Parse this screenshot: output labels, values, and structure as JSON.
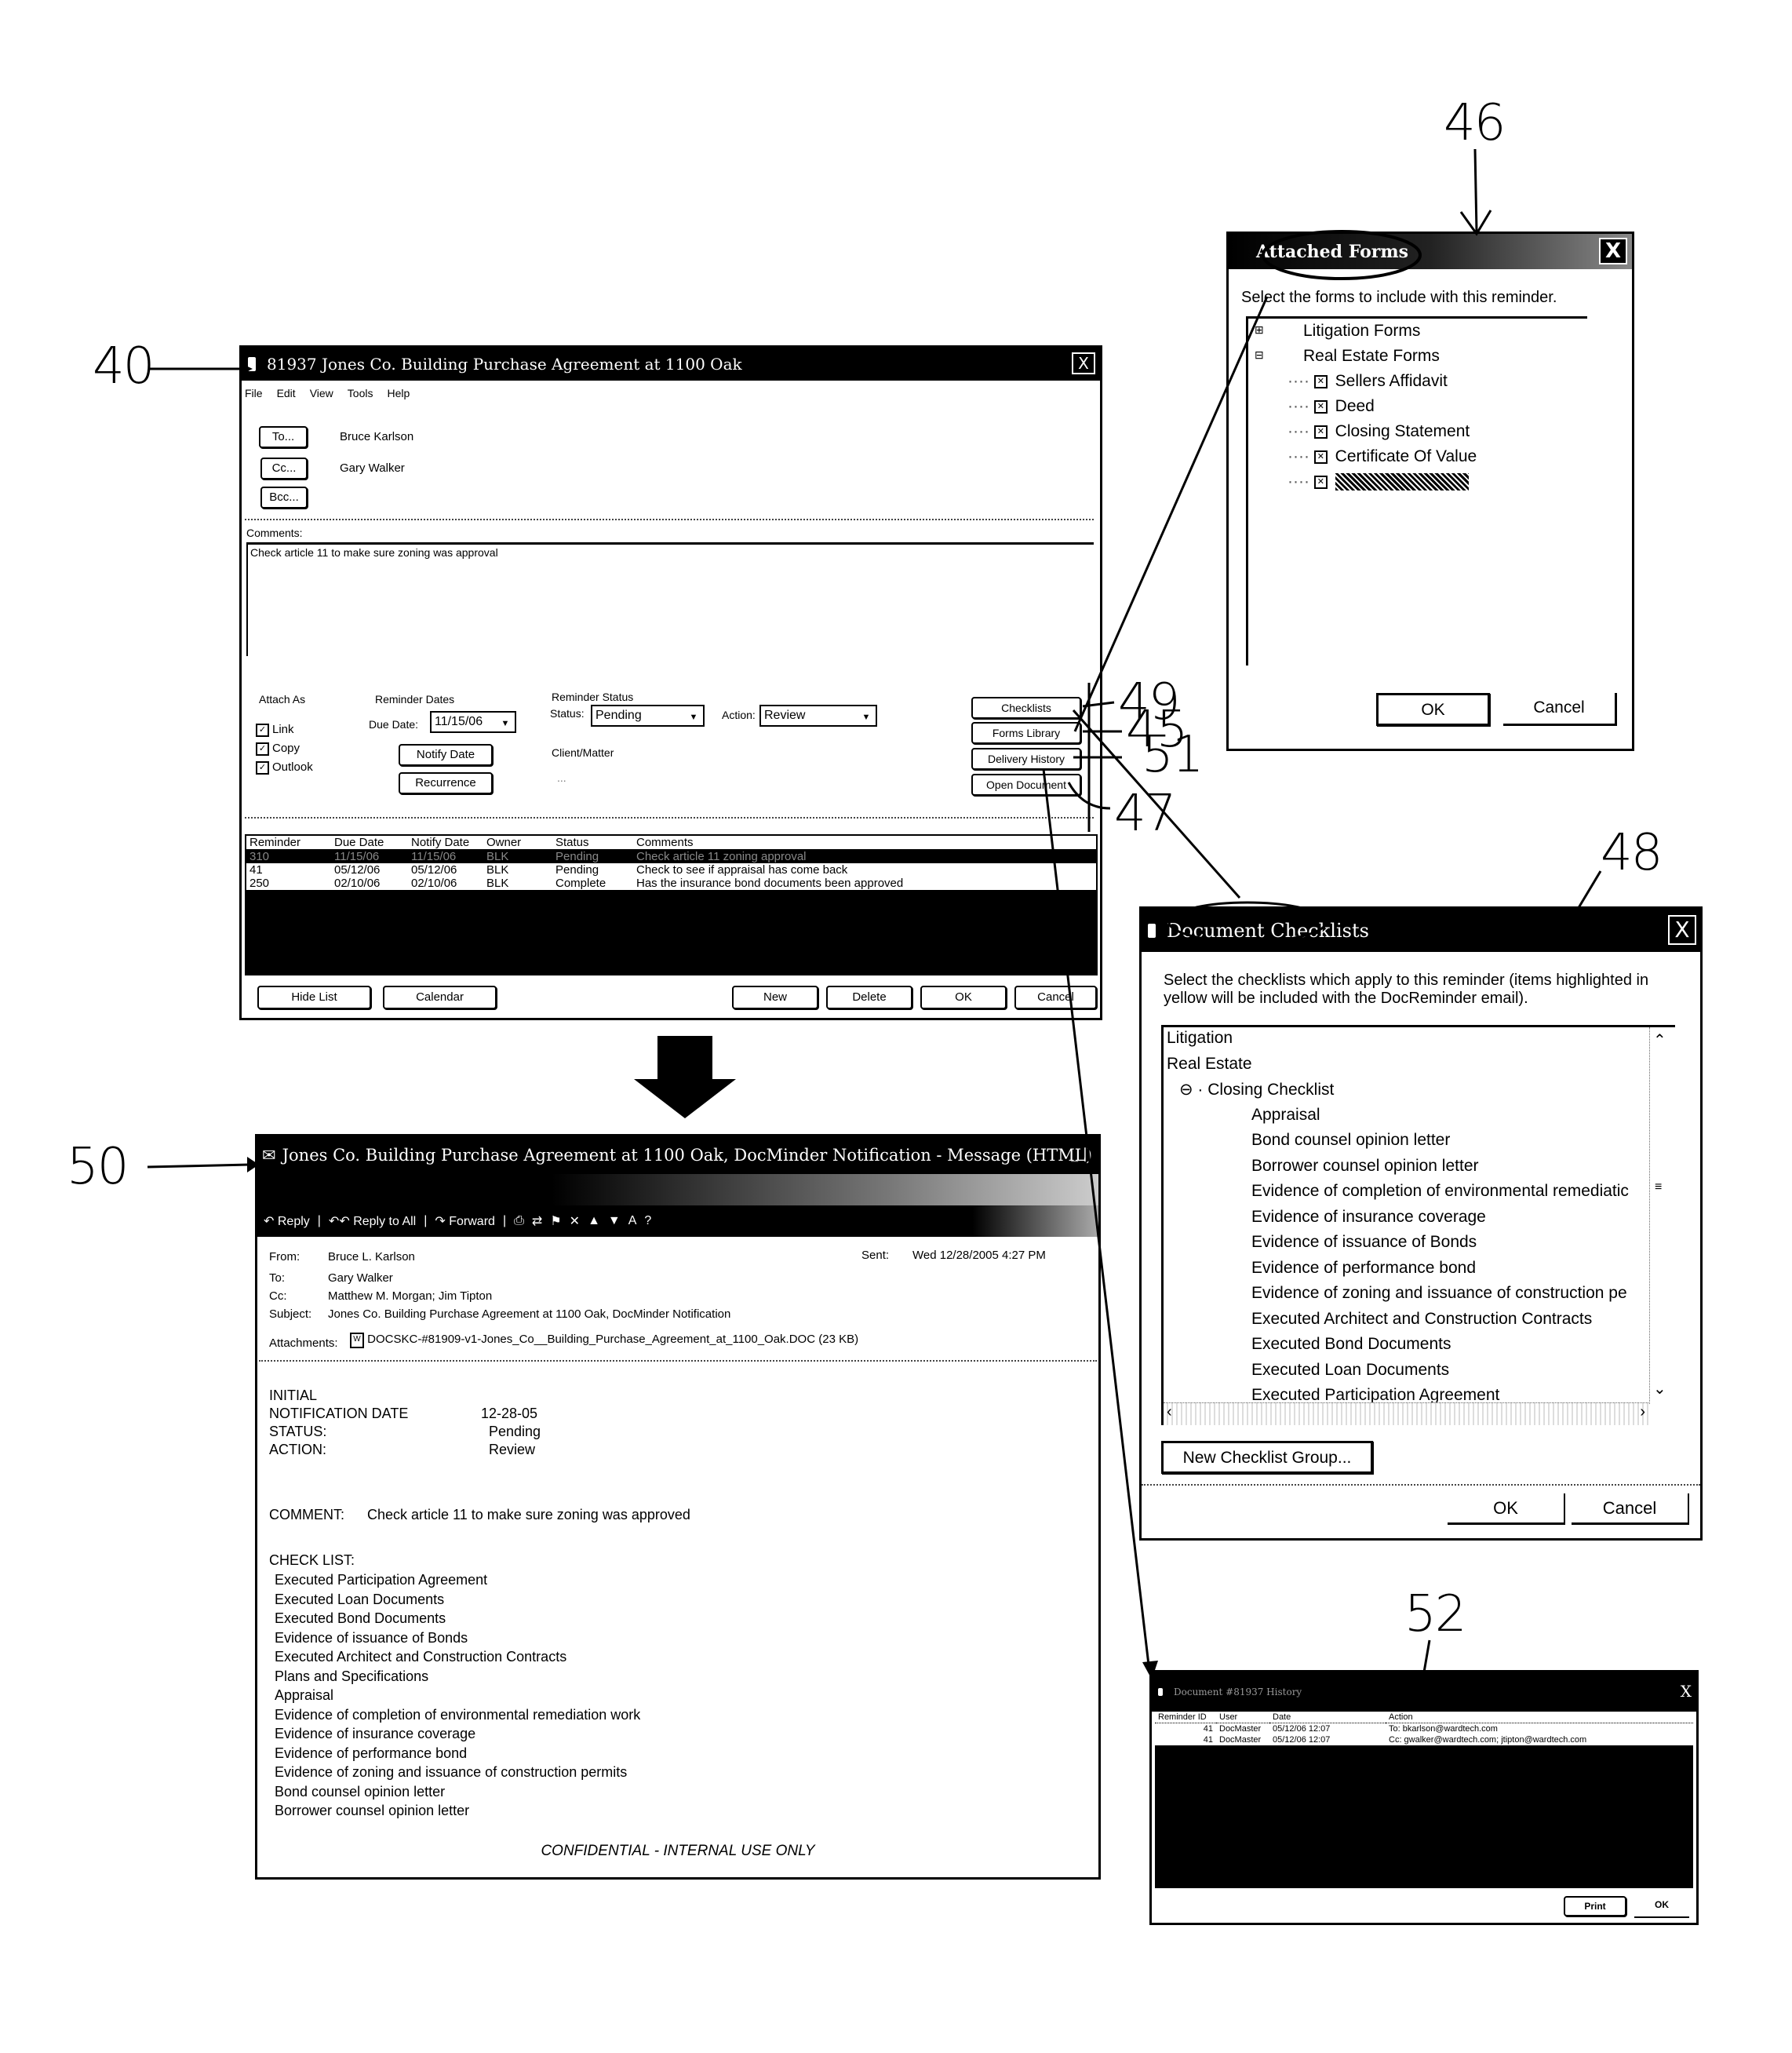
{
  "figure": {
    "ref_numerals": {
      "main_window": "40",
      "attached_forms": "46",
      "checklists_button": "49",
      "forms_library_button": "45",
      "delivery_history_button": "51",
      "open_document_button": "47",
      "document_checklists": "48",
      "email_message": "50",
      "history_window": "52"
    }
  },
  "reminder_window": {
    "title": "81937 Jones Co. Building Purchase Agreement at 1100 Oak",
    "close_label": "X",
    "menu": [
      "File",
      "Edit",
      "View",
      "Tools",
      "Help"
    ],
    "to_button": "To...",
    "cc_button": "Cc...",
    "bcc_button": "Bcc...",
    "to_value": "Bruce Karlson",
    "cc_value": "Gary Walker",
    "bcc_value": "",
    "comments_label": "Comments:",
    "comments_value": "Check article 11 to make sure zoning was approval",
    "attach_as_label": "Attach As",
    "attach_options": [
      {
        "label": "Link",
        "checked": true
      },
      {
        "label": "Copy",
        "checked": true
      },
      {
        "label": "Outlook",
        "checked": true
      }
    ],
    "reminder_dates_label": "Reminder Dates",
    "due_date_label": "Due Date:",
    "due_date_value": "11/15/06",
    "notify_date_button": "Notify Date",
    "recurrence_button": "Recurrence",
    "reminder_status_label": "Reminder Status",
    "status_label": "Status:",
    "status_value": "Pending",
    "action_label": "Action:",
    "action_value": "Review",
    "client_matter_label": "Client/Matter",
    "client_matter_value": "...",
    "checklists_button": "Checklists",
    "forms_library_button": "Forms Library",
    "delivery_history_button": "Delivery History",
    "open_document_button": "Open Document",
    "table": {
      "columns": [
        "Reminder",
        "Due Date",
        "Notify Date",
        "Owner",
        "Status",
        "Comments"
      ],
      "rows": [
        {
          "reminder": "310",
          "due": "11/15/06",
          "notify": "11/15/06",
          "owner": "BLK",
          "status": "Pending",
          "comments": "Check article 11 zoning approval",
          "selected": true
        },
        {
          "reminder": "41",
          "due": "05/12/06",
          "notify": "05/12/06",
          "owner": "BLK",
          "status": "Pending",
          "comments": "Check to see if appraisal has come back",
          "selected": false
        },
        {
          "reminder": "250",
          "due": "02/10/06",
          "notify": "02/10/06",
          "owner": "BLK",
          "status": "Complete",
          "comments": "Has the insurance bond documents been approved",
          "selected": false
        }
      ]
    },
    "hide_list_button": "Hide List",
    "calendar_button": "Calendar",
    "new_button": "New",
    "delete_button": "Delete",
    "ok_button": "OK",
    "cancel_button": "Cancel"
  },
  "attached_forms": {
    "title": "Attached Forms",
    "close_label": "X",
    "instruction": "Select the forms to include with this reminder.",
    "groups": [
      {
        "label": "Litigation Forms",
        "expanded": false,
        "items": []
      },
      {
        "label": "Real Estate Forms",
        "expanded": true,
        "items": [
          {
            "label": "Sellers Affidavit",
            "checked": true
          },
          {
            "label": "Deed",
            "checked": true
          },
          {
            "label": "Closing Statement",
            "checked": true
          },
          {
            "label": "Certificate Of Value",
            "checked": true
          },
          {
            "label": "",
            "checked": true,
            "highlighted": true
          }
        ]
      }
    ],
    "ok_button": "OK",
    "cancel_button": "Cancel"
  },
  "document_checklists": {
    "title": "Document Checklists",
    "close_label": "X",
    "instruction": "Select the checklists which apply to this reminder (items highlighted in yellow will be included with the DocReminder email).",
    "tree": [
      {
        "label": "Litigation",
        "level": 0
      },
      {
        "label": "Real Estate",
        "level": 0
      },
      {
        "label": "Closing Checklist",
        "level": 1,
        "expanded": true
      },
      {
        "label": "Appraisal",
        "level": 2
      },
      {
        "label": "Bond counsel opinion letter",
        "level": 2
      },
      {
        "label": "Borrower counsel opinion letter",
        "level": 2
      },
      {
        "label": "Evidence of completion of environmental remediatic",
        "level": 2
      },
      {
        "label": "Evidence of insurance coverage",
        "level": 2
      },
      {
        "label": "Evidence of issuance of Bonds",
        "level": 2
      },
      {
        "label": "Evidence of performance bond",
        "level": 2
      },
      {
        "label": "Evidence of zoning and issuance of construction pe",
        "level": 2
      },
      {
        "label": "Executed Architect and Construction Contracts",
        "level": 2
      },
      {
        "label": "Executed Bond Documents",
        "level": 2
      },
      {
        "label": "Executed Loan Documents",
        "level": 2
      },
      {
        "label": "Executed Participation Agreement",
        "level": 2
      }
    ],
    "new_group_button": "New Checklist Group...",
    "ok_button": "OK",
    "cancel_button": "Cancel"
  },
  "email": {
    "title": "Jones Co. Building Purchase Agreement at 1100 Oak, DocMinder Notification - Message (HTML)",
    "toolbar": {
      "reply": "Reply",
      "reply_all": "Reply to All",
      "forward": "Forward"
    },
    "from_label": "From:",
    "from_value": "Bruce L. Karlson",
    "sent_label": "Sent:",
    "sent_value": "Wed 12/28/2005 4:27 PM",
    "to_label": "To:",
    "to_value": "Gary Walker",
    "cc_label": "Cc:",
    "cc_value": "Matthew M. Morgan; Jim Tipton",
    "subject_label": "Subject:",
    "subject_value": "Jones Co. Building Purchase Agreement at 1100 Oak, DocMinder Notification",
    "attachments_label": "Attachments:",
    "attachment_value": "DOCSKC-#81909-v1-Jones_Co__Building_Purchase_Agreement_at_1100_Oak.DOC (23 KB)",
    "body": {
      "initial_label": "INITIAL",
      "notification_date_label": "NOTIFICATION DATE",
      "notification_date_value": "12-28-05",
      "status_label": "STATUS:",
      "status_value": "Pending",
      "action_label": "ACTION:",
      "action_value": "Review",
      "comment_label": "COMMENT:",
      "comment_value": "Check article 11 to make sure zoning was approved",
      "checklist_label": "CHECK LIST:",
      "checklist": [
        "Executed Participation Agreement",
        "Executed Loan Documents",
        "Executed Bond Documents",
        "Evidence of issuance of Bonds",
        "Executed Architect and Construction Contracts",
        "Plans and Specifications",
        "Appraisal",
        "Evidence of completion of environmental remediation work",
        "Evidence of insurance coverage",
        "Evidence of performance bond",
        "Evidence of zoning and issuance of construction permits",
        "Bond counsel opinion letter",
        "Borrower counsel opinion letter"
      ],
      "footer": "CONFIDENTIAL - INTERNAL USE ONLY"
    }
  },
  "history": {
    "title": "Document #81937 History",
    "close_label": "X",
    "columns": [
      "Reminder ID",
      "User",
      "Date",
      "Action"
    ],
    "rows": [
      {
        "id": "41",
        "user": "DocMaster",
        "date": "05/12/06 12:07",
        "action": "To: bkarlson@wardtech.com"
      },
      {
        "id": "41",
        "user": "DocMaster",
        "date": "05/12/06 12:07",
        "action": "Cc: gwalker@wardtech.com; jtipton@wardtech.com"
      }
    ],
    "print_button": "Print",
    "ok_button": "OK"
  }
}
